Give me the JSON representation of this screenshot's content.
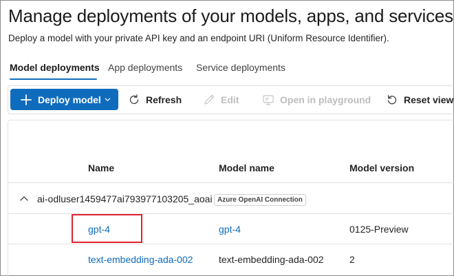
{
  "page": {
    "title": "Manage deployments of your models, apps, and services",
    "subtitle": "Deploy a model with your private API key and an endpoint URI (Uniform Resource Identifier)."
  },
  "tabs": [
    {
      "label": "Model deployments",
      "active": true
    },
    {
      "label": "App deployments",
      "active": false
    },
    {
      "label": "Service deployments",
      "active": false
    }
  ],
  "toolbar": {
    "deploy_model": "Deploy model",
    "refresh": "Refresh",
    "edit": "Edit",
    "open_in_playground": "Open in playground",
    "reset_view": "Reset view"
  },
  "table": {
    "columns": [
      "Name",
      "Model name",
      "Model version"
    ],
    "group": {
      "label": "ai-odluser1459477ai793977103205_aoai",
      "badge": "Azure OpenAI Connection"
    },
    "rows": [
      {
        "name": "gpt-4",
        "model_name": "gpt-4",
        "model_version": "0125-Preview",
        "model_name_is_link": true
      },
      {
        "name": "text-embedding-ada-002",
        "model_name": "text-embedding-ada-002",
        "model_version": "2",
        "model_name_is_link": false
      }
    ]
  },
  "colors": {
    "accent": "#0f6cbd",
    "highlight": "#e0212e"
  }
}
